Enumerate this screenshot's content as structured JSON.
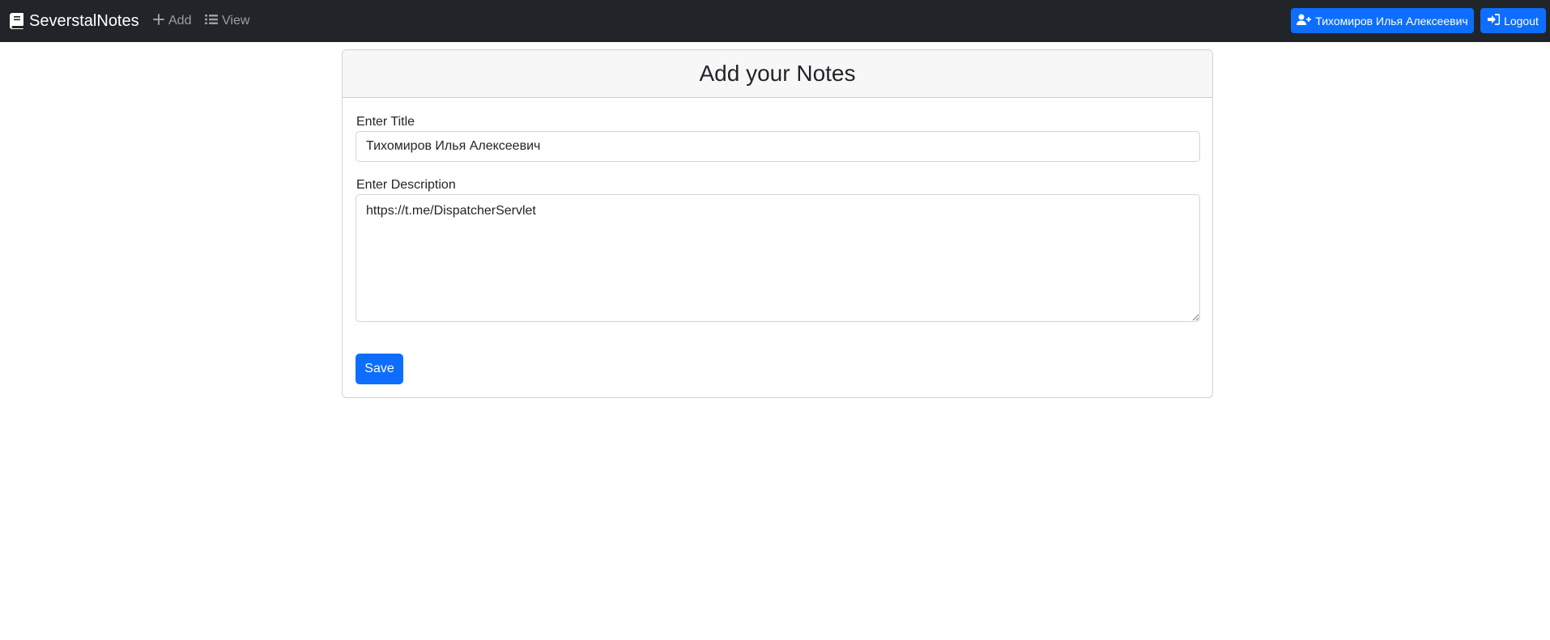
{
  "navbar": {
    "brand": "SeverstalNotes",
    "brand_icon": "book-icon",
    "links": [
      {
        "label": "Add",
        "icon": "plus-icon"
      },
      {
        "label": "View",
        "icon": "list-icon"
      }
    ],
    "user_button": {
      "label": "Тихомиров Илья Алексеевич",
      "icon": "user-plus-icon"
    },
    "logout_button": {
      "label": "Logout",
      "icon": "sign-in-icon"
    }
  },
  "card": {
    "title": "Add your Notes",
    "title_label": "Enter Title",
    "title_value": "Тихомиров Илья Алексеевич",
    "description_label": "Enter Description",
    "description_value": "https://t.me/DispatcherServlet",
    "save_label": "Save"
  },
  "colors": {
    "navbar_bg": "#212529",
    "primary": "#0d6efd",
    "card_header_bg": "#f7f7f7"
  }
}
